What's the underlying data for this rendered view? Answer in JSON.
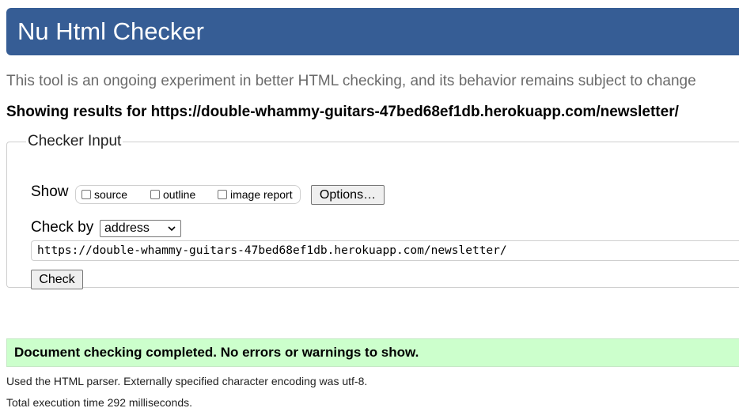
{
  "header": {
    "title": "Nu Html Checker"
  },
  "tagline": "This tool is an ongoing experiment in better HTML checking, and its behavior remains subject to change",
  "results": {
    "prefix": "Showing results for",
    "url": "https://double-whammy-guitars-47bed68ef1db.herokuapp.com/newsletter/"
  },
  "checker_input": {
    "legend": "Checker Input",
    "show_label": "Show",
    "show_options": [
      {
        "label": "source",
        "checked": false
      },
      {
        "label": "outline",
        "checked": false
      },
      {
        "label": "image report",
        "checked": false
      }
    ],
    "options_button": "Options…",
    "check_by_label": "Check by",
    "check_by_selected": "address",
    "url_value": "https://double-whammy-guitars-47bed68ef1db.herokuapp.com/newsletter/",
    "check_button": "Check"
  },
  "status": {
    "message": "Document checking completed. No errors or warnings to show.",
    "color": "#ccffcc"
  },
  "details": {
    "parser": "Used the HTML parser. Externally specified character encoding was utf-8.",
    "time": "Total execution time 292 milliseconds."
  },
  "colors": {
    "header_bg": "#365d95",
    "tagline": "#6b6b6b"
  }
}
